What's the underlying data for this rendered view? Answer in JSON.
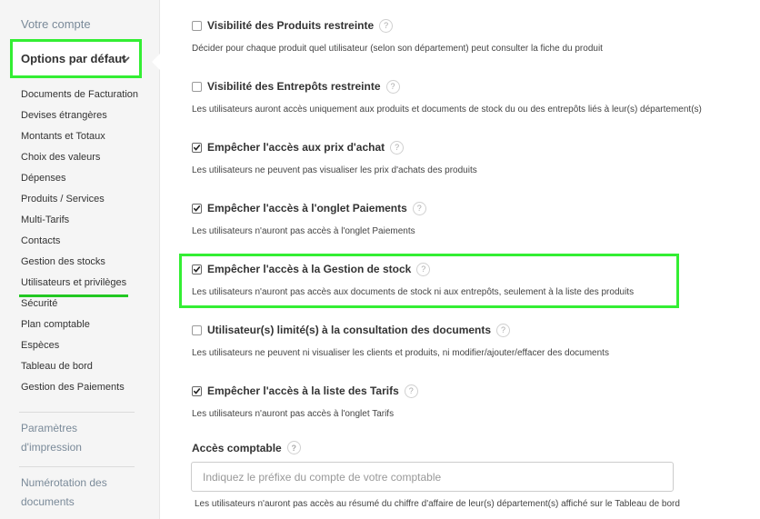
{
  "sidebar": {
    "top_link": "Votre compte",
    "active_group": "Options par défaut",
    "items": [
      {
        "label": "Documents de Facturation"
      },
      {
        "label": "Devises étrangères"
      },
      {
        "label": "Montants et Totaux"
      },
      {
        "label": "Choix des valeurs"
      },
      {
        "label": "Dépenses"
      },
      {
        "label": "Produits / Services"
      },
      {
        "label": "Multi-Tarifs"
      },
      {
        "label": "Contacts"
      },
      {
        "label": "Gestion des stocks"
      },
      {
        "label": "Utilisateurs et privilèges"
      },
      {
        "label": "Sécurité"
      },
      {
        "label": "Plan comptable"
      },
      {
        "label": "Espèces"
      },
      {
        "label": "Tableau de bord"
      },
      {
        "label": "Gestion des Paiements"
      }
    ],
    "section2": {
      "line1": "Paramètres",
      "line2": "d'impression"
    },
    "section3": {
      "line1": "Numérotation des",
      "line2": "documents"
    }
  },
  "options": [
    {
      "label": "Visibilité des Produits restreinte",
      "checked": false,
      "description": "Décider pour chaque produit quel utilisateur (selon son département) peut consulter la fiche du produit"
    },
    {
      "label": "Visibilité des Entrepôts restreinte",
      "checked": false,
      "description": "Les utilisateurs auront accès uniquement aux produits et documents de stock du ou des entrepôts liés à leur(s) département(s)"
    },
    {
      "label": "Empêcher l'accès aux prix d'achat",
      "checked": true,
      "description": "Les utilisateurs ne peuvent pas visualiser les prix d'achats des produits"
    },
    {
      "label": "Empêcher l'accès à l'onglet Paiements",
      "checked": true,
      "description": "Les utilisateurs n'auront pas accès à l'onglet Paiements"
    },
    {
      "label": "Empêcher l'accès à la Gestion de stock",
      "checked": true,
      "description": "Les utilisateurs n'auront pas accès aux documents de stock ni aux entrepôts, seulement à la liste des produits"
    },
    {
      "label": "Utilisateur(s) limité(s) à la consultation des documents",
      "checked": false,
      "description": "Les utilisateurs ne peuvent ni visualiser les clients et produits, ni modifier/ajouter/effacer des documents"
    },
    {
      "label": "Empêcher l'accès à la liste des Tarifs",
      "checked": true,
      "description": "Les utilisateurs n'auront pas accès à l'onglet Tarifs"
    }
  ],
  "accounting": {
    "title": "Accès comptable",
    "placeholder": "Indiquez le préfixe du compte de votre comptable",
    "value": "",
    "description": "Les utilisateurs n'auront pas accès au résumé du chiffre d'affaire de leur(s) département(s) affiché sur le Tableau de bord"
  },
  "help_glyph": "?",
  "icons": {
    "checkbox_checked": "check-icon",
    "help": "question-circle-icon",
    "chevron": "chevron-down-icon"
  },
  "colors": {
    "highlight": "#33ee33",
    "current_underline": "#22c822",
    "sidebar_bg": "#f5f5f5"
  }
}
